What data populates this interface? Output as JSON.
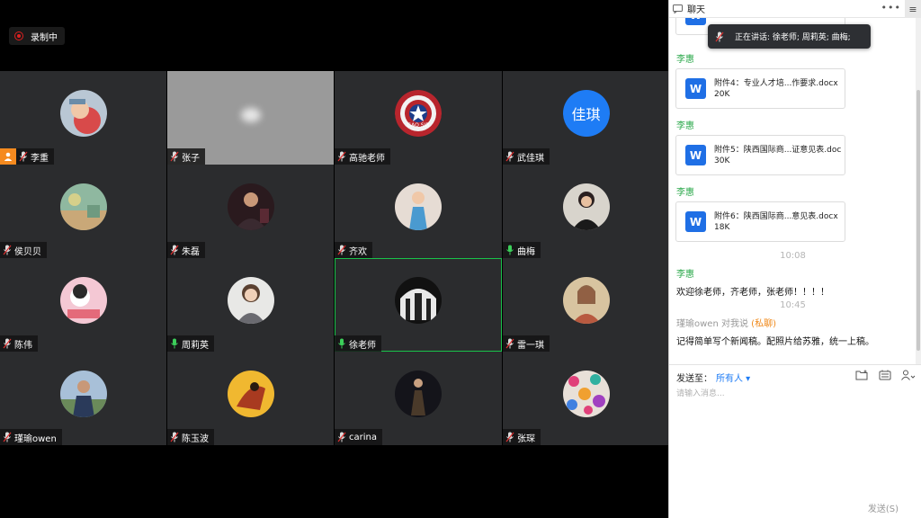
{
  "recording": {
    "label": "录制中"
  },
  "tiles": [
    {
      "name": "李重",
      "host": true,
      "avatar": "photo-kid"
    },
    {
      "name": "张子",
      "gray": true
    },
    {
      "name": "高驰老师",
      "avatar": "captain-shield"
    },
    {
      "name": "武佳琪",
      "avatar_text": "佳琪"
    },
    {
      "name": "侯贝贝",
      "avatar": "painting-green"
    },
    {
      "name": "朱磊",
      "avatar": "photo-man-dark"
    },
    {
      "name": "齐欢",
      "avatar": "photo-girl-blue"
    },
    {
      "name": "曲梅",
      "avatar": "photo-woman",
      "mic_on": true
    },
    {
      "name": "陈伟",
      "avatar": "cartoon-pink"
    },
    {
      "name": "周莉英",
      "avatar": "photo-woman-light",
      "mic_on": true
    },
    {
      "name": "徐老师",
      "avatar": "building-arch",
      "mic_on": true,
      "active": true
    },
    {
      "name": "雷一琪",
      "avatar": "painting-portrait"
    },
    {
      "name": "瑾瑜owen",
      "avatar": "photo-man-outdoor"
    },
    {
      "name": "陈玉波",
      "avatar": "art-yellow"
    },
    {
      "name": "carina",
      "avatar": "dark-figure"
    },
    {
      "name": "张琛",
      "avatar": "pattern-colorful"
    }
  ],
  "chat": {
    "title": "聊天",
    "speaking": "正在讲话: 徐老师; 周莉英; 曲梅;",
    "messages": {
      "s1": "李惠",
      "f1_name": "附件4：专业人才培...作要求.docx",
      "f1_size": "20K",
      "s2": "李惠",
      "f2_name": "附件5：陕西国际商...证意见表.doc",
      "f2_size": "30K",
      "s3": "李惠",
      "f3_name": "附件6：陕西国际商...意见表.docx",
      "f3_size": "18K",
      "t1": "10:08",
      "s4": "李惠",
      "m1": "欢迎徐老师，齐老师，张老师！！！！",
      "t2": "10:45",
      "meta_from": "瑾瑜owen",
      "meta_to": "对我说",
      "meta_priv": "(私聊)",
      "m2": "记得简单写个新闻稿。配照片给苏雅，统一上稿。"
    },
    "send_to_label": "发送至：",
    "recipient": "所有人",
    "input_placeholder": "请输入消息...",
    "send_button": "发送(S)"
  },
  "colors": {
    "accent": "#1e7cf5",
    "sender": "#2aa84a",
    "active_border": "#19c24a",
    "host_badge": "#f58a1f",
    "private": "#f08a1c"
  }
}
